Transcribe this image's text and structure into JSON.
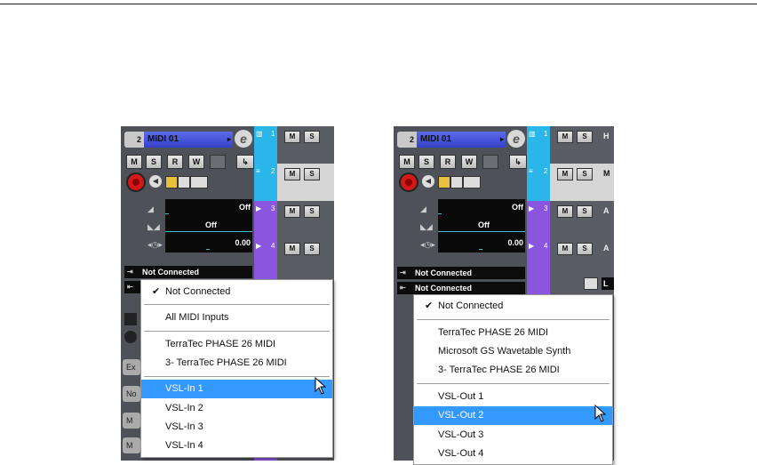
{
  "left": {
    "track_number": "2",
    "track_name": "MIDI 01",
    "btn_labels": [
      "M",
      "S",
      "R",
      "W"
    ],
    "fader_values": [
      "Off",
      "Off",
      "0.00"
    ],
    "input_routing": "Not Connected",
    "side_buttons": [
      "Ex",
      "No",
      "M",
      "M"
    ],
    "tracks": [
      {
        "num": "1",
        "m": "M",
        "s": "S"
      },
      {
        "num": "2",
        "m": "M",
        "s": "S"
      },
      {
        "num": "3",
        "m": "M",
        "s": "S"
      },
      {
        "num": "4",
        "m": "M",
        "s": "S"
      }
    ],
    "menu": {
      "checked": "Not Connected",
      "group1": [
        "All MIDI Inputs"
      ],
      "group2": [
        "TerraTec PHASE 26 MIDI",
        "3- TerraTec PHASE 26 MIDI"
      ],
      "group3": [
        "VSL-In 1",
        "VSL-In 2",
        "VSL-In 3",
        "VSL-In 4"
      ],
      "selected_index": 0
    }
  },
  "right": {
    "track_number": "2",
    "track_name": "MIDI 01",
    "btn_labels": [
      "M",
      "S",
      "R",
      "W"
    ],
    "fader_values": [
      "Off",
      "Off",
      "0.00"
    ],
    "input_routing": "Not Connected",
    "output_routing": "Not Connected",
    "tracks": [
      {
        "num": "1",
        "m": "M",
        "s": "S",
        "label": "H"
      },
      {
        "num": "2",
        "m": "M",
        "s": "S",
        "label": "M"
      },
      {
        "num": "3",
        "m": "M",
        "s": "S",
        "label": "A"
      },
      {
        "num": "4",
        "m": "M",
        "s": "S",
        "label": "A"
      }
    ],
    "lane_text": "L",
    "menu": {
      "checked": "Not Connected",
      "group1": [
        "TerraTec PHASE 26 MIDI",
        "Microsoft GS Wavetable Synth",
        "3- TerraTec PHASE 26 MIDI"
      ],
      "group2": [
        "VSL-Out 1",
        "VSL-Out 2",
        "VSL-Out 3",
        "VSL-Out 4"
      ],
      "selected_index": 1
    }
  },
  "colors": {
    "track_cyan": "#2ab6e8",
    "track_purple": "#8a56e0",
    "highlight": "#3399ff",
    "record": "#d21818"
  },
  "icons": [
    "edit-icon",
    "record-icon",
    "monitor-icon",
    "input-icon",
    "output-icon",
    "checkmark-icon",
    "mouse-cursor-icon"
  ]
}
